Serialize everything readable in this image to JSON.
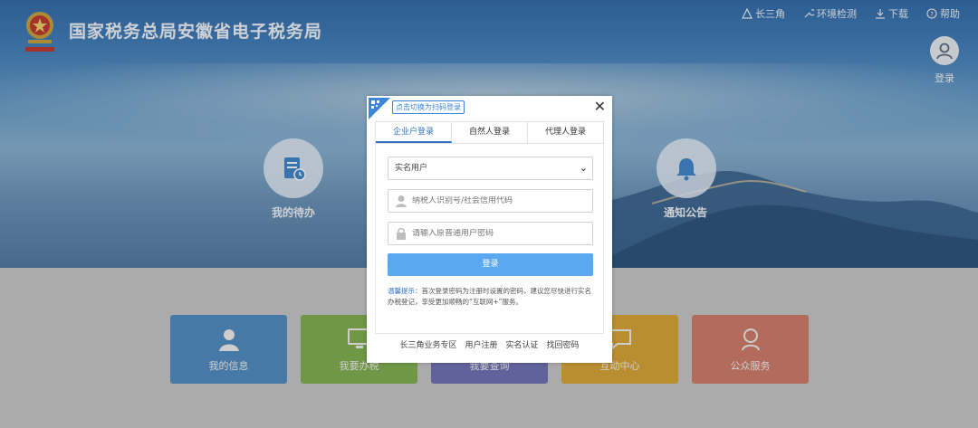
{
  "header": {
    "site_title": "国家税务总局安徽省电子税务局",
    "links": [
      {
        "label": "长三角",
        "icon": "triangle-icon"
      },
      {
        "label": "环境检测",
        "icon": "wrench-icon"
      },
      {
        "label": "下载",
        "icon": "download-icon"
      },
      {
        "label": "帮助",
        "icon": "help-circle-icon"
      }
    ],
    "login_label": "登录"
  },
  "banner": {
    "left_feature": {
      "label": "我的待办",
      "icon": "todo-document-icon"
    },
    "right_feature": {
      "label": "通知公告",
      "icon": "bell-icon"
    }
  },
  "tiles": [
    {
      "label": "我的信息",
      "color": "#4d8cc1",
      "icon": "user-icon"
    },
    {
      "label": "我要办税",
      "color": "#7fb04c",
      "icon": "monitor-icon"
    },
    {
      "label": "我要查询",
      "color": "#6e6fb5",
      "icon": "search-icon"
    },
    {
      "label": "互动中心",
      "color": "#d8a534",
      "icon": "chat-icon"
    },
    {
      "label": "公众服务",
      "color": "#d27a68",
      "icon": "service-icon"
    }
  ],
  "modal": {
    "qr_tip": "点击切换为扫码登录",
    "close": "✕",
    "tabs": [
      {
        "label": "企业户登录",
        "active": true
      },
      {
        "label": "自然人登录",
        "active": false
      },
      {
        "label": "代理人登录",
        "active": false
      }
    ],
    "user_type_select": {
      "selected": "实名用户"
    },
    "taxpayer_id_field": {
      "placeholder": "纳税人识别号/社会信用代码"
    },
    "password_field": {
      "placeholder": "请输入原普通用户密码"
    },
    "login_button": "登录",
    "tip": {
      "label": "温馨提示",
      "text": "：首次登录密码为注册时设置的密码，建议您尽快进行实名办税登记，享受更加顺畅的“互联网+”服务。"
    },
    "footer_links": [
      "长三角业务专区",
      "用户注册",
      "实名认证",
      "找回密码"
    ]
  },
  "colors": {
    "accent": "#2f73c7",
    "login_button": "#5aa9f0",
    "tab_active": "#2f73c7"
  }
}
